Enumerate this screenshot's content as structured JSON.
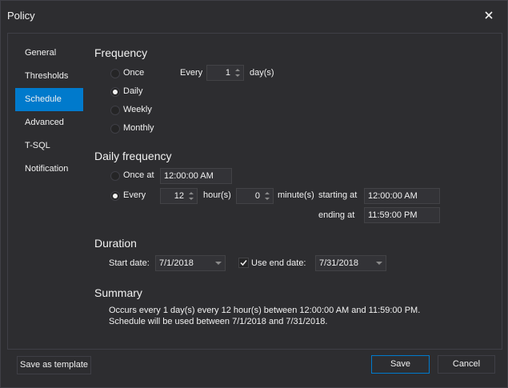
{
  "window": {
    "title": "Policy"
  },
  "nav": {
    "items": [
      {
        "label": "General"
      },
      {
        "label": "Thresholds"
      },
      {
        "label": "Schedule"
      },
      {
        "label": "Advanced"
      },
      {
        "label": "T-SQL"
      },
      {
        "label": "Notification"
      }
    ],
    "active_index": 2
  },
  "frequency": {
    "title": "Frequency",
    "options": [
      {
        "label": "Once",
        "selected": false
      },
      {
        "label": "Daily",
        "selected": true
      },
      {
        "label": "Weekly",
        "selected": false
      },
      {
        "label": "Monthly",
        "selected": false
      }
    ],
    "every_label": "Every",
    "every_value": "1",
    "unit_label": "day(s)"
  },
  "daily_frequency": {
    "title": "Daily frequency",
    "once_at_label": "Once at",
    "once_at_value": "12:00:00 AM",
    "once_selected": false,
    "every_label": "Every",
    "every_selected": true,
    "hours_value": "12",
    "hours_label": "hour(s)",
    "minutes_value": "0",
    "minutes_label": "minute(s)",
    "starting_at_label": "starting at",
    "starting_at_value": "12:00:00 AM",
    "ending_at_label": "ending at",
    "ending_at_value": "11:59:00 PM"
  },
  "duration": {
    "title": "Duration",
    "start_date_label": "Start date:",
    "start_date_value": "7/1/2018",
    "use_end_date_label": "Use end date:",
    "use_end_date_checked": true,
    "end_date_value": "7/31/2018"
  },
  "summary": {
    "title": "Summary",
    "line1": "Occurs every 1 day(s) every 12 hour(s) between 12:00:00 AM and 11:59:00 PM.",
    "line2": "Schedule will be used between 7/1/2018 and 7/31/2018."
  },
  "footer": {
    "save_template_label": "Save as template",
    "save_label": "Save",
    "cancel_label": "Cancel"
  },
  "colors": {
    "accent": "#007acc",
    "background": "#2d2d30",
    "border": "#3f3f46"
  },
  "icons": {
    "close": "close-icon",
    "spin_arrows": "spin-arrows-icon",
    "dropdown": "chevron-down-icon",
    "check": "checkmark-icon"
  }
}
